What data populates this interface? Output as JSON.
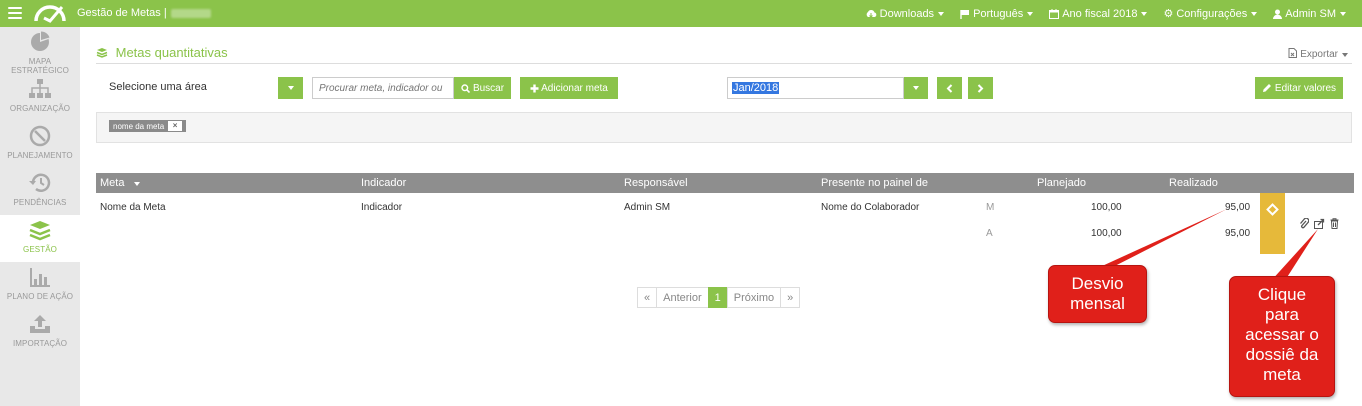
{
  "topbar": {
    "app_title": "Gestão de Metas |",
    "nav": [
      {
        "icon": "cloud-download-icon",
        "label": "Downloads"
      },
      {
        "icon": "flag-icon",
        "label": "Português"
      },
      {
        "icon": "calendar-icon",
        "label": "Ano fiscal 2018"
      },
      {
        "icon": "gear-icon",
        "label": "Configurações"
      },
      {
        "icon": "user-icon",
        "label": "Admin SM"
      }
    ],
    "color": "#8bc34a"
  },
  "sidebar": {
    "items": [
      {
        "icon": "pie-chart-icon",
        "label": "MAPA ESTRATÉGICO"
      },
      {
        "icon": "org-chart-icon",
        "label": "ORGANIZAÇÃO"
      },
      {
        "icon": "compass-icon",
        "label": "PLANEJAMENTO"
      },
      {
        "icon": "history-icon",
        "label": "PENDÊNCIAS"
      },
      {
        "icon": "layers-icon",
        "label": "GESTÃO",
        "active": true
      },
      {
        "icon": "bar-chart-icon",
        "label": "PLANO DE AÇÃO"
      },
      {
        "icon": "upload-icon",
        "label": "IMPORTAÇÃO"
      }
    ]
  },
  "page": {
    "title": "Metas quantitativas",
    "export_label": "Exportar"
  },
  "toolbar": {
    "area_label": "Selecione uma área",
    "search_placeholder": "Procurar meta, indicador ou",
    "search_button": "Buscar",
    "add_button": "Adicionar meta",
    "period_value": "Jan/2018",
    "edit_button": "Editar valores"
  },
  "filters": {
    "tag": "nome da meta"
  },
  "table": {
    "headers": {
      "meta": "Meta",
      "indicador": "Indicador",
      "responsavel": "Responsável",
      "painel": "Presente no painel de",
      "planejado": "Planejado",
      "realizado": "Realizado"
    },
    "row": {
      "meta": "Nome da Meta",
      "indicador": "Indicador",
      "responsavel": "Admin SM",
      "painel": "Nome do Colaborador",
      "m_label": "M",
      "m_planejado": "100,00",
      "m_realizado": "95,00",
      "a_label": "A",
      "a_planejado": "100,00",
      "a_realizado": "95,00",
      "status_color": "#e6b93a"
    }
  },
  "pagination": {
    "first": "«",
    "prev": "Anterior",
    "current": "1",
    "next": "Próximo",
    "last": "»"
  },
  "callouts": {
    "desvio": "Desvio mensal",
    "dossie": "Clique para acessar o dossiê da meta"
  }
}
